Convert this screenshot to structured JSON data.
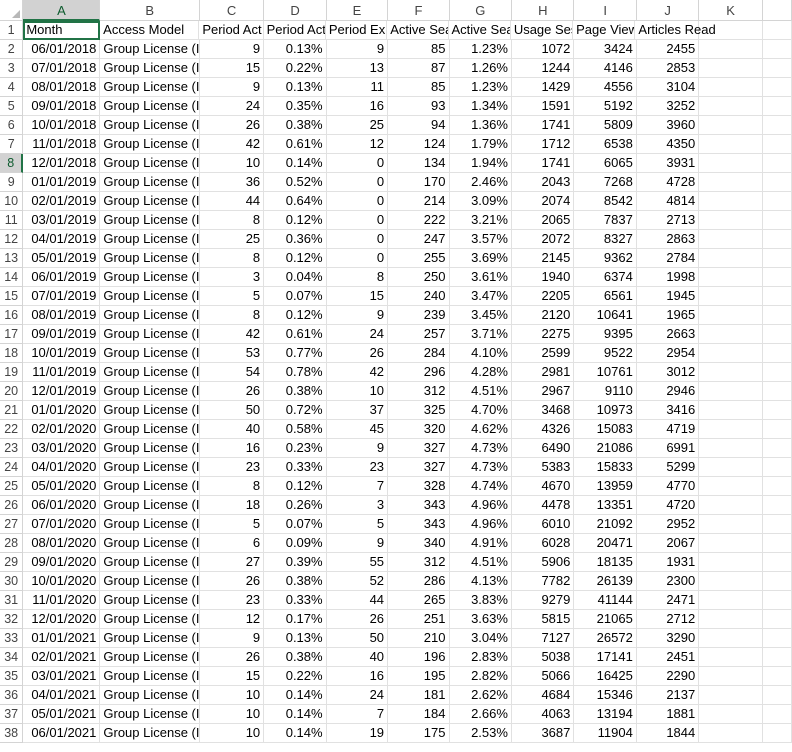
{
  "columns": [
    "A",
    "B",
    "C",
    "D",
    "E",
    "F",
    "G",
    "H",
    "I",
    "J",
    "K"
  ],
  "header_cells": [
    "Month",
    "Access Model",
    "Period Act",
    "Period Act",
    "Period Exp",
    "Active Sea",
    "Active Sea",
    "Usage Ses",
    "Page View",
    "Articles Read",
    ""
  ],
  "rows": [
    {
      "n": "2",
      "a": "06/01/2018",
      "b": "Group License (I",
      "c": "9",
      "d": "0.13%",
      "e": "9",
      "f": "85",
      "g": "1.23%",
      "h": "1072",
      "i": "3424",
      "j": "2455"
    },
    {
      "n": "3",
      "a": "07/01/2018",
      "b": "Group License (I",
      "c": "15",
      "d": "0.22%",
      "e": "13",
      "f": "87",
      "g": "1.26%",
      "h": "1244",
      "i": "4146",
      "j": "2853"
    },
    {
      "n": "4",
      "a": "08/01/2018",
      "b": "Group License (I",
      "c": "9",
      "d": "0.13%",
      "e": "11",
      "f": "85",
      "g": "1.23%",
      "h": "1429",
      "i": "4556",
      "j": "3104"
    },
    {
      "n": "5",
      "a": "09/01/2018",
      "b": "Group License (I",
      "c": "24",
      "d": "0.35%",
      "e": "16",
      "f": "93",
      "g": "1.34%",
      "h": "1591",
      "i": "5192",
      "j": "3252"
    },
    {
      "n": "6",
      "a": "10/01/2018",
      "b": "Group License (I",
      "c": "26",
      "d": "0.38%",
      "e": "25",
      "f": "94",
      "g": "1.36%",
      "h": "1741",
      "i": "5809",
      "j": "3960"
    },
    {
      "n": "7",
      "a": "11/01/2018",
      "b": "Group License (I",
      "c": "42",
      "d": "0.61%",
      "e": "12",
      "f": "124",
      "g": "1.79%",
      "h": "1712",
      "i": "6538",
      "j": "4350"
    },
    {
      "n": "8",
      "a": "12/01/2018",
      "b": "Group License (I",
      "c": "10",
      "d": "0.14%",
      "e": "0",
      "f": "134",
      "g": "1.94%",
      "h": "1741",
      "i": "6065",
      "j": "3931"
    },
    {
      "n": "9",
      "a": "01/01/2019",
      "b": "Group License (I",
      "c": "36",
      "d": "0.52%",
      "e": "0",
      "f": "170",
      "g": "2.46%",
      "h": "2043",
      "i": "7268",
      "j": "4728"
    },
    {
      "n": "10",
      "a": "02/01/2019",
      "b": "Group License (I",
      "c": "44",
      "d": "0.64%",
      "e": "0",
      "f": "214",
      "g": "3.09%",
      "h": "2074",
      "i": "8542",
      "j": "4814"
    },
    {
      "n": "11",
      "a": "03/01/2019",
      "b": "Group License (I",
      "c": "8",
      "d": "0.12%",
      "e": "0",
      "f": "222",
      "g": "3.21%",
      "h": "2065",
      "i": "7837",
      "j": "2713"
    },
    {
      "n": "12",
      "a": "04/01/2019",
      "b": "Group License (I",
      "c": "25",
      "d": "0.36%",
      "e": "0",
      "f": "247",
      "g": "3.57%",
      "h": "2072",
      "i": "8327",
      "j": "2863"
    },
    {
      "n": "13",
      "a": "05/01/2019",
      "b": "Group License (I",
      "c": "8",
      "d": "0.12%",
      "e": "0",
      "f": "255",
      "g": "3.69%",
      "h": "2145",
      "i": "9362",
      "j": "2784"
    },
    {
      "n": "14",
      "a": "06/01/2019",
      "b": "Group License (I",
      "c": "3",
      "d": "0.04%",
      "e": "8",
      "f": "250",
      "g": "3.61%",
      "h": "1940",
      "i": "6374",
      "j": "1998"
    },
    {
      "n": "15",
      "a": "07/01/2019",
      "b": "Group License (I",
      "c": "5",
      "d": "0.07%",
      "e": "15",
      "f": "240",
      "g": "3.47%",
      "h": "2205",
      "i": "6561",
      "j": "1945"
    },
    {
      "n": "16",
      "a": "08/01/2019",
      "b": "Group License (I",
      "c": "8",
      "d": "0.12%",
      "e": "9",
      "f": "239",
      "g": "3.45%",
      "h": "2120",
      "i": "10641",
      "j": "1965"
    },
    {
      "n": "17",
      "a": "09/01/2019",
      "b": "Group License (I",
      "c": "42",
      "d": "0.61%",
      "e": "24",
      "f": "257",
      "g": "3.71%",
      "h": "2275",
      "i": "9395",
      "j": "2663"
    },
    {
      "n": "18",
      "a": "10/01/2019",
      "b": "Group License (I",
      "c": "53",
      "d": "0.77%",
      "e": "26",
      "f": "284",
      "g": "4.10%",
      "h": "2599",
      "i": "9522",
      "j": "2954"
    },
    {
      "n": "19",
      "a": "11/01/2019",
      "b": "Group License (I",
      "c": "54",
      "d": "0.78%",
      "e": "42",
      "f": "296",
      "g": "4.28%",
      "h": "2981",
      "i": "10761",
      "j": "3012"
    },
    {
      "n": "20",
      "a": "12/01/2019",
      "b": "Group License (I",
      "c": "26",
      "d": "0.38%",
      "e": "10",
      "f": "312",
      "g": "4.51%",
      "h": "2967",
      "i": "9110",
      "j": "2946"
    },
    {
      "n": "21",
      "a": "01/01/2020",
      "b": "Group License (I",
      "c": "50",
      "d": "0.72%",
      "e": "37",
      "f": "325",
      "g": "4.70%",
      "h": "3468",
      "i": "10973",
      "j": "3416"
    },
    {
      "n": "22",
      "a": "02/01/2020",
      "b": "Group License (I",
      "c": "40",
      "d": "0.58%",
      "e": "45",
      "f": "320",
      "g": "4.62%",
      "h": "4326",
      "i": "15083",
      "j": "4719"
    },
    {
      "n": "23",
      "a": "03/01/2020",
      "b": "Group License (I",
      "c": "16",
      "d": "0.23%",
      "e": "9",
      "f": "327",
      "g": "4.73%",
      "h": "6490",
      "i": "21086",
      "j": "6991"
    },
    {
      "n": "24",
      "a": "04/01/2020",
      "b": "Group License (I",
      "c": "23",
      "d": "0.33%",
      "e": "23",
      "f": "327",
      "g": "4.73%",
      "h": "5383",
      "i": "15833",
      "j": "5299"
    },
    {
      "n": "25",
      "a": "05/01/2020",
      "b": "Group License (I",
      "c": "8",
      "d": "0.12%",
      "e": "7",
      "f": "328",
      "g": "4.74%",
      "h": "4670",
      "i": "13959",
      "j": "4770"
    },
    {
      "n": "26",
      "a": "06/01/2020",
      "b": "Group License (I",
      "c": "18",
      "d": "0.26%",
      "e": "3",
      "f": "343",
      "g": "4.96%",
      "h": "4478",
      "i": "13351",
      "j": "4720"
    },
    {
      "n": "27",
      "a": "07/01/2020",
      "b": "Group License (I",
      "c": "5",
      "d": "0.07%",
      "e": "5",
      "f": "343",
      "g": "4.96%",
      "h": "6010",
      "i": "21092",
      "j": "2952"
    },
    {
      "n": "28",
      "a": "08/01/2020",
      "b": "Group License (I",
      "c": "6",
      "d": "0.09%",
      "e": "9",
      "f": "340",
      "g": "4.91%",
      "h": "6028",
      "i": "20471",
      "j": "2067"
    },
    {
      "n": "29",
      "a": "09/01/2020",
      "b": "Group License (I",
      "c": "27",
      "d": "0.39%",
      "e": "55",
      "f": "312",
      "g": "4.51%",
      "h": "5906",
      "i": "18135",
      "j": "1931"
    },
    {
      "n": "30",
      "a": "10/01/2020",
      "b": "Group License (I",
      "c": "26",
      "d": "0.38%",
      "e": "52",
      "f": "286",
      "g": "4.13%",
      "h": "7782",
      "i": "26139",
      "j": "2300"
    },
    {
      "n": "31",
      "a": "11/01/2020",
      "b": "Group License (I",
      "c": "23",
      "d": "0.33%",
      "e": "44",
      "f": "265",
      "g": "3.83%",
      "h": "9279",
      "i": "41144",
      "j": "2471"
    },
    {
      "n": "32",
      "a": "12/01/2020",
      "b": "Group License (I",
      "c": "12",
      "d": "0.17%",
      "e": "26",
      "f": "251",
      "g": "3.63%",
      "h": "5815",
      "i": "21065",
      "j": "2712"
    },
    {
      "n": "33",
      "a": "01/01/2021",
      "b": "Group License (I",
      "c": "9",
      "d": "0.13%",
      "e": "50",
      "f": "210",
      "g": "3.04%",
      "h": "7127",
      "i": "26572",
      "j": "3290"
    },
    {
      "n": "34",
      "a": "02/01/2021",
      "b": "Group License (I",
      "c": "26",
      "d": "0.38%",
      "e": "40",
      "f": "196",
      "g": "2.83%",
      "h": "5038",
      "i": "17141",
      "j": "2451"
    },
    {
      "n": "35",
      "a": "03/01/2021",
      "b": "Group License (I",
      "c": "15",
      "d": "0.22%",
      "e": "16",
      "f": "195",
      "g": "2.82%",
      "h": "5066",
      "i": "16425",
      "j": "2290"
    },
    {
      "n": "36",
      "a": "04/01/2021",
      "b": "Group License (I",
      "c": "10",
      "d": "0.14%",
      "e": "24",
      "f": "181",
      "g": "2.62%",
      "h": "4684",
      "i": "15346",
      "j": "2137"
    },
    {
      "n": "37",
      "a": "05/01/2021",
      "b": "Group License (I",
      "c": "10",
      "d": "0.14%",
      "e": "7",
      "f": "184",
      "g": "2.66%",
      "h": "4063",
      "i": "13194",
      "j": "1881"
    },
    {
      "n": "38",
      "a": "06/01/2021",
      "b": "Group License (I",
      "c": "10",
      "d": "0.14%",
      "e": "19",
      "f": "175",
      "g": "2.53%",
      "h": "3687",
      "i": "11904",
      "j": "1844"
    }
  ],
  "header_row_number": "1",
  "selected_row": "8",
  "selected_column": "A",
  "colors": {
    "accent": "#217346",
    "header_selected_bg": "#d2d2d2",
    "grid": "#e1e1e1"
  }
}
